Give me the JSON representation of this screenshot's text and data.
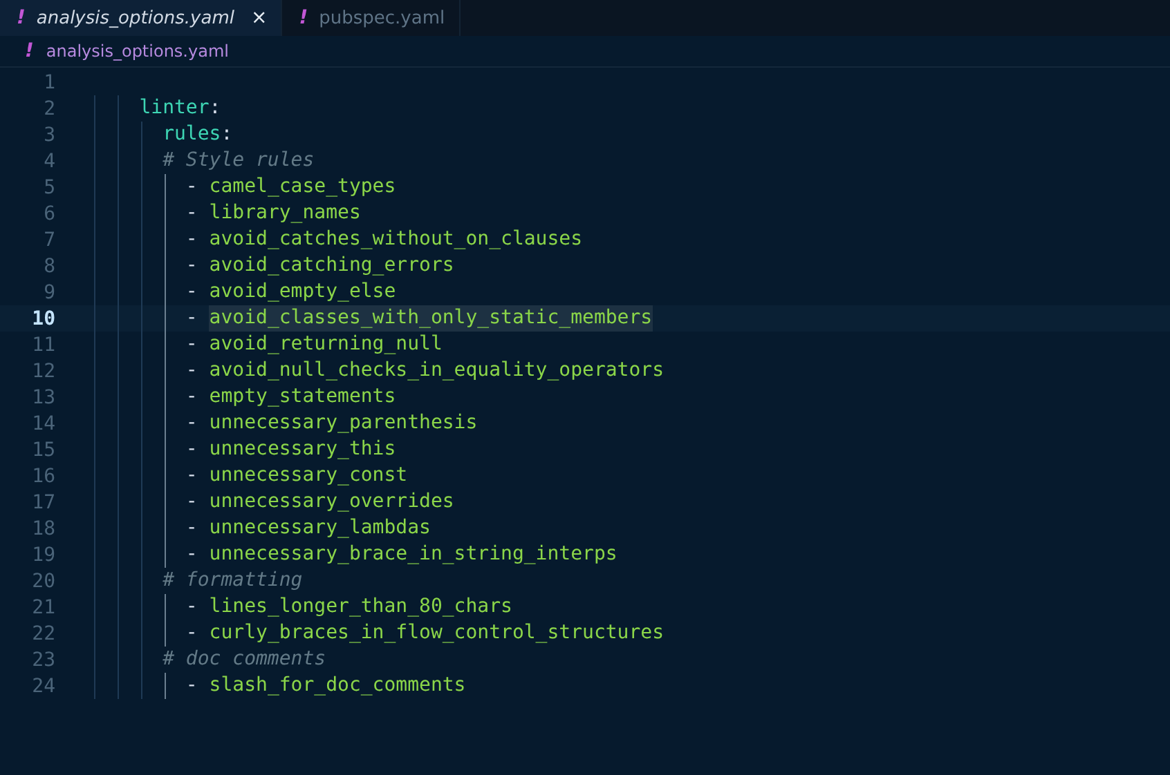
{
  "tabs": [
    {
      "icon": "!",
      "label": "analysis_options.yaml",
      "selected": true,
      "preview": true,
      "close": "×"
    },
    {
      "icon": "!",
      "label": "pubspec.yaml",
      "selected": false,
      "preview": false
    }
  ],
  "breadcrumb": {
    "icon": "!",
    "label": "analysis_options.yaml"
  },
  "editor": {
    "lines": [
      {
        "number": "1",
        "kind": "blank",
        "current": false
      },
      {
        "number": "2",
        "kind": "key",
        "text": "    linter:",
        "current": false
      },
      {
        "number": "3",
        "kind": "key",
        "text": "      rules:",
        "current": false
      },
      {
        "number": "4",
        "kind": "comment",
        "text": "      # Style rules",
        "current": false
      },
      {
        "number": "5",
        "kind": "item",
        "text": "        - camel_case_types",
        "current": false
      },
      {
        "number": "6",
        "kind": "item",
        "text": "        - library_names",
        "current": false
      },
      {
        "number": "7",
        "kind": "item",
        "text": "        - avoid_catches_without_on_clauses",
        "current": false
      },
      {
        "number": "8",
        "kind": "item",
        "text": "        - avoid_catching_errors",
        "current": false
      },
      {
        "number": "9",
        "kind": "item",
        "text": "        - avoid_empty_else",
        "current": false
      },
      {
        "number": "10",
        "kind": "item",
        "text": "        - avoid_classes_with_only_static_members",
        "current": true
      },
      {
        "number": "11",
        "kind": "item",
        "text": "        - avoid_returning_null",
        "current": false
      },
      {
        "number": "12",
        "kind": "item",
        "text": "        - avoid_null_checks_in_equality_operators",
        "current": false
      },
      {
        "number": "13",
        "kind": "item",
        "text": "        - empty_statements",
        "current": false
      },
      {
        "number": "14",
        "kind": "item",
        "text": "        - unnecessary_parenthesis",
        "current": false
      },
      {
        "number": "15",
        "kind": "item",
        "text": "        - unnecessary_this",
        "current": false
      },
      {
        "number": "16",
        "kind": "item",
        "text": "        - unnecessary_const",
        "current": false
      },
      {
        "number": "17",
        "kind": "item",
        "text": "        - unnecessary_overrides",
        "current": false
      },
      {
        "number": "18",
        "kind": "item",
        "text": "        - unnecessary_lambdas",
        "current": false
      },
      {
        "number": "19",
        "kind": "item",
        "text": "        - unnecessary_brace_in_string_interps",
        "current": false
      },
      {
        "number": "20",
        "kind": "comment",
        "text": "      # formatting",
        "current": false
      },
      {
        "number": "21",
        "kind": "item",
        "text": "        - lines_longer_than_80_chars",
        "current": false
      },
      {
        "number": "22",
        "kind": "item",
        "text": "        - curly_braces_in_flow_control_structures",
        "current": false
      },
      {
        "number": "23",
        "kind": "comment",
        "text": "      # doc comments",
        "current": false
      },
      {
        "number": "24",
        "kind": "item",
        "text": "        - slash_for_doc_comments",
        "current": false
      }
    ]
  }
}
